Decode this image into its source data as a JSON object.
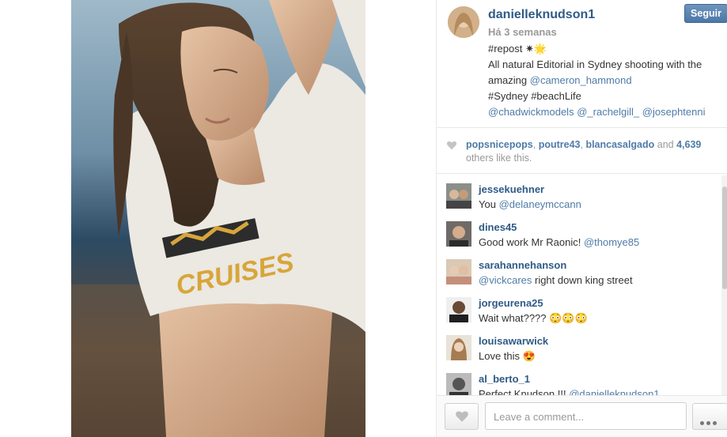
{
  "post": {
    "username": "danielleknudson1",
    "follow_label": "Seguir",
    "time": "Há 3 semanas",
    "caption": {
      "line1": "#repost ✷🌟",
      "line2": "All natural Editorial in Sydney shooting with the",
      "line3_prefix": "amazing ",
      "line3_mention": "@cameron_hammond",
      "line4": "#Sydney #beachLife",
      "line5_m1": "@chadwickmodels",
      "line5_m2": "@_rachelgill_",
      "line5_m3": "@josephtenni"
    }
  },
  "likes": {
    "users": [
      "popsnicepops",
      "poutre43",
      "blancasalgado"
    ],
    "sep1": ", ",
    "sep2": ", ",
    "and": " and ",
    "count": "4,639",
    "suffix": "others like this."
  },
  "comments": [
    {
      "user": "jessekuehner",
      "text_prefix": "You ",
      "mention": "@delaneymccann",
      "text_suffix": ""
    },
    {
      "user": "dines45",
      "text_prefix": "Good work Mr Raonic! ",
      "mention": "@thomye85",
      "text_suffix": ""
    },
    {
      "user": "sarahannehanson",
      "text_prefix": "",
      "mention": "@vickcares",
      "text_suffix": " right down king street"
    },
    {
      "user": "jorgeurena25",
      "text_prefix": "Wait what???? 😳😳😳",
      "mention": "",
      "text_suffix": ""
    },
    {
      "user": "louisawarwick",
      "text_prefix": "Love this 😍",
      "mention": "",
      "text_suffix": ""
    },
    {
      "user": "al_berto_1",
      "text_prefix": "Perfect Knudson !!! ",
      "mention": "@danielleknudson1",
      "text_suffix": ""
    }
  ],
  "comment_input": {
    "placeholder": "Leave a comment..."
  },
  "icons": {
    "like": "heart-icon",
    "more": "more-dots-icon"
  },
  "colors": {
    "link": "#2f5b85",
    "mention": "#4f7ba8",
    "follow_button": "#4c78a6",
    "muted": "#999999"
  }
}
